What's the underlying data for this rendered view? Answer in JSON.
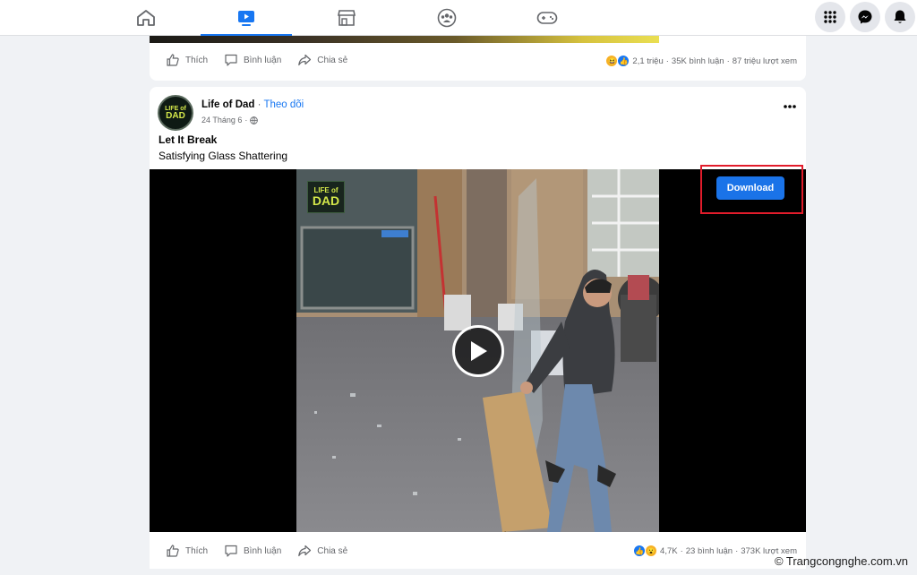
{
  "nav": {
    "tabs": [
      {
        "name": "home-icon",
        "active": false
      },
      {
        "name": "watch-icon",
        "active": true
      },
      {
        "name": "marketplace-icon",
        "active": false
      },
      {
        "name": "groups-icon",
        "active": false
      },
      {
        "name": "gaming-icon",
        "active": false
      }
    ],
    "right_buttons": [
      "menu-grid-icon",
      "messenger-icon",
      "notifications-icon"
    ]
  },
  "previous_post": {
    "actions": {
      "like": "Thích",
      "comment": "Bình luận",
      "share": "Chia sẻ"
    },
    "reaction_count": "2,1 triệu",
    "comments": "35K bình luận",
    "views": "87 triệu lượt xem"
  },
  "post": {
    "page_name": "Life of Dad",
    "separator": " · ",
    "follow_label": "Theo dõi",
    "date": "24 Tháng 6",
    "date_separator": " · ",
    "title": "Let It Break",
    "description": "Satisfying Glass Shattering",
    "video_logo": {
      "line1": "LIFE of",
      "line2": "DAD"
    },
    "download_label": "Download",
    "actions": {
      "like": "Thích",
      "comment": "Bình luận",
      "share": "Chia sẻ"
    },
    "reaction_count": "4,7K",
    "comments": "23 bình luận",
    "views": "373K lượt xem"
  },
  "watermark": "© Trangcongnghe.com.vn",
  "colors": {
    "accent": "#1877f2",
    "download_button": "#1a73e8",
    "highlight_box": "#e21c2b"
  }
}
